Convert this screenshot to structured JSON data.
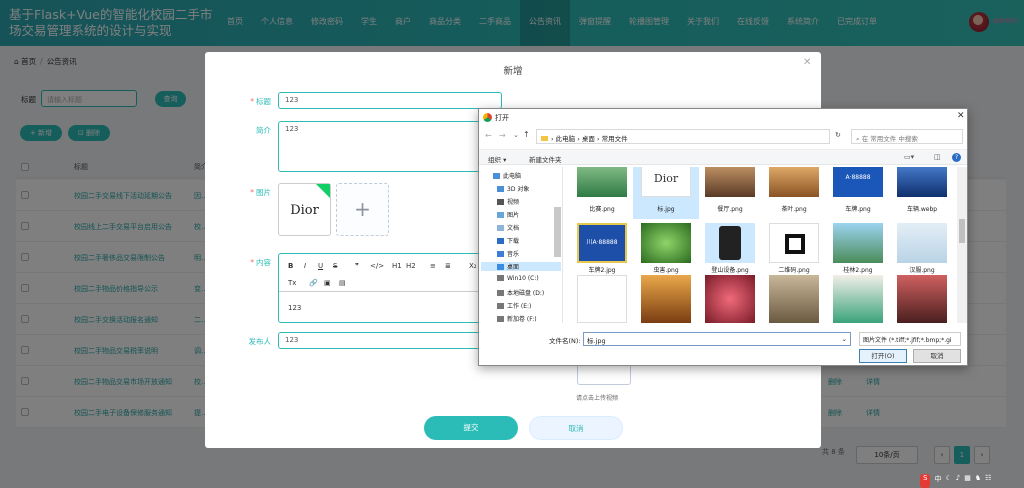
{
  "header": {
    "title": "基于Flask+Vue的智能化校园二手市场交易管理系统的设计与实现",
    "nav": [
      "首页",
      "个人信息",
      "修改密码",
      "学生",
      "商户",
      "商品分类",
      "二手商品",
      "公告资讯",
      "弹窗提醒",
      "轮播图管理",
      "关于我们",
      "在线反馈",
      "系统简介",
      "已完成订单"
    ],
    "active_index": 7,
    "user": "admin"
  },
  "breadcrumb": {
    "home": "首页",
    "current": "公告资讯"
  },
  "filter": {
    "label": "标题",
    "placeholder": "请输入标题",
    "search": "查询"
  },
  "actions": {
    "add": "+ 新增",
    "delete": "删除"
  },
  "table": {
    "headers": [
      "标题",
      "简介"
    ],
    "rows": [
      {
        "title": "校园二手交易线下活动延期公告",
        "intro": "因..."
      },
      {
        "title": "校园线上二手交易平台启用公告",
        "intro": "校..."
      },
      {
        "title": "校园二手奢侈品交易限制公告",
        "intro": "明..."
      },
      {
        "title": "校园二手物品价格指导公示",
        "intro": "变..."
      },
      {
        "title": "校园二手交换活动报名通知",
        "intro": "二..."
      },
      {
        "title": "校园二手物品交易税率说明",
        "intro": "调..."
      },
      {
        "title": "校园二手物品交易市场开放通知",
        "intro": "校..."
      },
      {
        "title": "校园二手电子设备保修服务通知",
        "intro": "提..."
      }
    ],
    "row_actions": [
      "删除",
      "详情"
    ]
  },
  "pagination": {
    "total": "共 8 条",
    "page_size": "10条/页",
    "page": "1"
  },
  "modal": {
    "title": "新增",
    "fields": {
      "title_label": "标题",
      "title_value": "123",
      "intro_label": "简介",
      "intro_value": "123",
      "image_label": "图片",
      "image_logo": "Dior",
      "content_label": "内容",
      "content_value": "123",
      "publisher_label": "发布人",
      "publisher_value": "123"
    },
    "editor_tools": [
      "B",
      "I",
      "U",
      "S",
      "❞",
      "</>",
      "H1",
      "H2",
      "≡",
      "≣",
      "X₂",
      "Tx",
      "🔗",
      "▣",
      "▤"
    ],
    "upload_hint": "请点击上传视频",
    "submit": "提交",
    "cancel": "取消"
  },
  "file_dialog": {
    "title": "打开",
    "path": [
      "此电脑",
      "桌面",
      "常用文件"
    ],
    "search_placeholder": "在 常用文件 中搜索",
    "organize": "组织 ▾",
    "new_folder": "新建文件夹",
    "tree": [
      "此电脑",
      "3D 对象",
      "视频",
      "图片",
      "文档",
      "下载",
      "音乐",
      "桌面",
      "Win10 (C:)",
      "本地磁盘 (D:)",
      "工作 (E:)",
      "新加卷 (F:)"
    ],
    "tree_selected": 7,
    "files": [
      "比赛.png",
      "标.jpg",
      "餐厅.png",
      "茶叶.png",
      "车牌.png",
      "车辆.webp",
      "车牌2.jpg",
      "虫害.png",
      "登山设备.png",
      "二维码.png",
      "桂林2.png",
      "汉服.png",
      "",
      "",
      "",
      "",
      "",
      ""
    ],
    "selected_file": 8,
    "filename_label": "文件名(N):",
    "filename": "标.jpg",
    "filetype": "图片文件 (*.tiff;*.jfif;*.bmp;*.gi",
    "open": "打开(O)",
    "cancel": "取消"
  },
  "tray": {
    "ime": "中"
  }
}
